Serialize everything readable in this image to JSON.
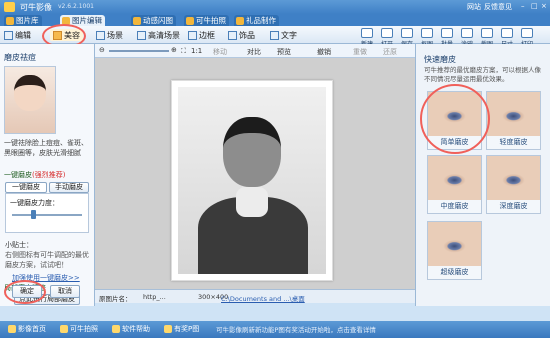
{
  "window": {
    "title": "可牛影像",
    "version": "v2.6.2.1001",
    "links": [
      "网站",
      "反馈意见"
    ]
  },
  "main_tabs": [
    "图片库",
    "图片编辑",
    "动感闪图",
    "可牛拍照",
    "礼品制作"
  ],
  "toolbar": {
    "left": [
      "编辑",
      "美容",
      "场景",
      "高清场景",
      "边框",
      "饰品",
      "文字"
    ],
    "right": [
      "新建",
      "打开",
      "保存",
      "抠图",
      "批量",
      "涂鸦",
      "截图",
      "尺寸",
      "打印"
    ]
  },
  "subtoolbar": {
    "zoom": "1:1",
    "items": [
      "移动",
      "对比",
      "预览",
      "撤销",
      "重做",
      "还原"
    ]
  },
  "left_panel": {
    "title": "磨皮祛痘",
    "description": "一键祛除脸上痘痘、雀斑、黑眼圈等，皮肤光滑细腻",
    "section1": {
      "label": "一键磨皮",
      "recommend": "(强烈推荐)",
      "tabs": [
        "一键磨皮",
        "手动磨皮"
      ],
      "strength_label": "一键磨皮力度：",
      "strength": 0.3
    },
    "tip_title": "小贴士：",
    "tip": "右侧图标有可牛调配的最优磨皮方案，试试吧！",
    "section2": {
      "label": "局部磨皮精修",
      "button": "点此进行局部磨皮"
    },
    "link": "加强使用一键磨皮>>",
    "ok": "确定",
    "cancel": "取消"
  },
  "canvas": {
    "name_label": "原图片名：",
    "name_value": "http_...",
    "size": "300×400",
    "path": "C:\\Documents and ...\\桌面"
  },
  "right_panel": {
    "title": "快速磨皮",
    "description": "可牛推荐的最优磨皮方案，可以根据人像不同情况尽量运用最优效果。",
    "options": [
      "简单磨皮",
      "轻度磨皮",
      "中度磨皮",
      "深度磨皮",
      "超级磨皮"
    ]
  },
  "bottom_bar": {
    "items": [
      "影像首页",
      "可牛拍照",
      "软件帮助",
      "有奖P图"
    ],
    "tip": "可牛影像刷新新功能P图有奖活动开始啦，点击查看详情"
  },
  "colors": {
    "accent": "#3f80c6",
    "highlight": "#f0605a",
    "recommend": "#d62b2b"
  }
}
